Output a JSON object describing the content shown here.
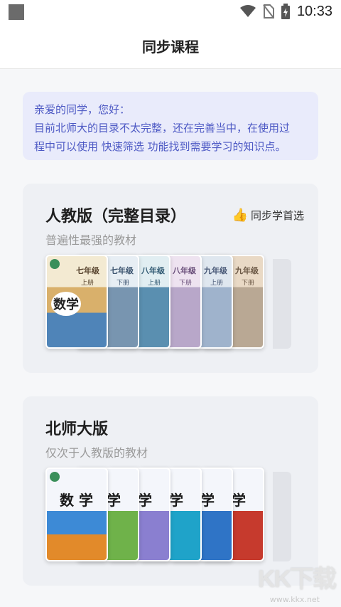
{
  "status_bar": {
    "time": "10:33"
  },
  "header": {
    "title": "同步课程"
  },
  "notice": {
    "line1": "亲爱的同学，您好：",
    "line2": "目前北师大的目录不太完整，还在完善当中，在使用过",
    "line3": "程中可以使用 快速筛选 功能找到需要学习的知识点。"
  },
  "cards": [
    {
      "title": "人教版（完整目录）",
      "subtitle": "普遍性最强的教材",
      "badge": "同步学首选",
      "books": [
        {
          "grade": "七年级",
          "volume": "上册",
          "subject": "数学"
        },
        {
          "grade": "七年级",
          "volume": "下册"
        },
        {
          "grade": "八年级",
          "volume": "上册"
        },
        {
          "grade": "八年级",
          "volume": "下册"
        },
        {
          "grade": "九年级",
          "volume": "上册"
        },
        {
          "grade": "九年级",
          "volume": "下册"
        }
      ]
    },
    {
      "title": "北师大版",
      "subtitle": "仅次于人教版的教材",
      "books": [
        {
          "subject": "数 学"
        },
        {
          "subject": "学"
        },
        {
          "subject": "学"
        },
        {
          "subject": "学"
        },
        {
          "subject": "学"
        },
        {
          "subject": "学"
        }
      ]
    }
  ],
  "watermark": {
    "logo": "KK下载",
    "url": "www.kkx.net"
  },
  "colors": {
    "accent": "#4d59c4",
    "notice_bg": "#e9ebfb",
    "card_bg": "#eef0f4"
  }
}
